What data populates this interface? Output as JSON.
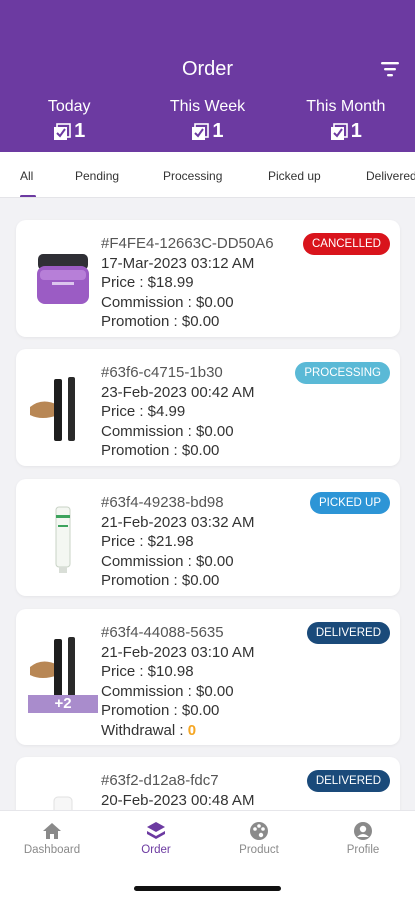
{
  "header": {
    "title": "Order",
    "filter_icon": "filter-icon",
    "stats": [
      {
        "label": "Today",
        "value": "1"
      },
      {
        "label": "This Week",
        "value": "1"
      },
      {
        "label": "This Month",
        "value": "1"
      }
    ]
  },
  "tabs": [
    "All",
    "Pending",
    "Processing",
    "Picked up",
    "Delivered"
  ],
  "active_tab": "All",
  "orders": [
    {
      "id": "#F4FE4-12663C-DD50A6",
      "date": "17-Mar-2023 03:12 AM",
      "price": "Price : $18.99",
      "commission": "Commission : $0.00",
      "promotion": "Promotion : $0.00",
      "status": "CANCELLED",
      "status_color": "#d9141c",
      "product_image": "purple-cream-jar"
    },
    {
      "id": "#63f6-c4715-1b30",
      "date": "23-Feb-2023 00:42 AM",
      "price": "Price : $4.99",
      "commission": "Commission : $0.00",
      "promotion": "Promotion : $0.00",
      "status": "PROCESSING",
      "status_color": "#5ab9d6",
      "product_image": "mascara-brush"
    },
    {
      "id": "#63f4-49238-bd98",
      "date": "21-Feb-2023 03:32 AM",
      "price": "Price : $21.98",
      "commission": "Commission : $0.00",
      "promotion": "Promotion : $0.00",
      "status": "PICKED UP",
      "status_color": "#2d95d6",
      "product_image": "green-tube"
    },
    {
      "id": "#63f4-44088-5635",
      "date": "21-Feb-2023 03:10 AM",
      "price": "Price : $10.98",
      "commission": "Commission : $0.00",
      "promotion": "Promotion : $0.00",
      "withdrawal_label": "Withdrawal : ",
      "withdrawal_value": "0",
      "extra_items": "+2",
      "status": "DELIVERED",
      "status_color": "#1a4a7a",
      "product_image": "mascara-brush"
    },
    {
      "id": "#63f2-d12a8-fdc7",
      "date": "20-Feb-2023 00:48 AM",
      "status": "DELIVERED",
      "status_color": "#1a4a7a",
      "product_image": "white-bottle"
    }
  ],
  "bottom_nav": [
    {
      "label": "Dashboard",
      "icon": "home-icon"
    },
    {
      "label": "Order",
      "icon": "layers-icon",
      "active": true
    },
    {
      "label": "Product",
      "icon": "palette-icon"
    },
    {
      "label": "Profile",
      "icon": "user-icon"
    }
  ],
  "colors": {
    "primary": "#6c3aa1",
    "background": "#f2f2f5",
    "withdrawal": "#f5a623"
  }
}
